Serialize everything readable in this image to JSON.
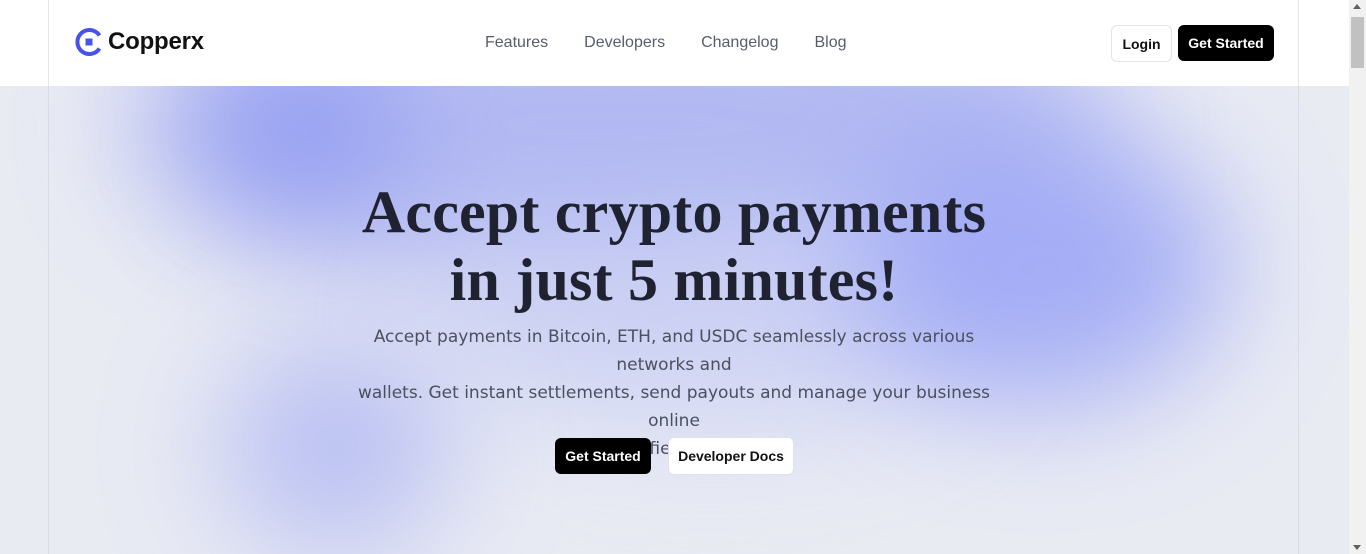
{
  "header": {
    "logo_text": "Copperx",
    "logo_icon": "copperx-logo-icon",
    "nav": [
      {
        "label": "Features"
      },
      {
        "label": "Developers"
      },
      {
        "label": "Changelog"
      },
      {
        "label": "Blog"
      }
    ],
    "login_label": "Login",
    "get_started_label": "Get Started"
  },
  "hero": {
    "title_line1": "Accept crypto payments",
    "title_line2": "in just 5 minutes!",
    "subtitle_line1": "Accept payments in Bitcoin, ETH, and USDC seamlessly across various networks and",
    "subtitle_line2": "wallets. Get instant settlements, send payouts and manage your business online",
    "subtitle_line3": "with a unified dashboard.",
    "primary_cta": "Get Started",
    "secondary_cta": "Developer Docs"
  },
  "colors": {
    "brand_blue": "#4753e6",
    "button_dark": "#000000",
    "hero_glow": "#9aa4f6"
  }
}
